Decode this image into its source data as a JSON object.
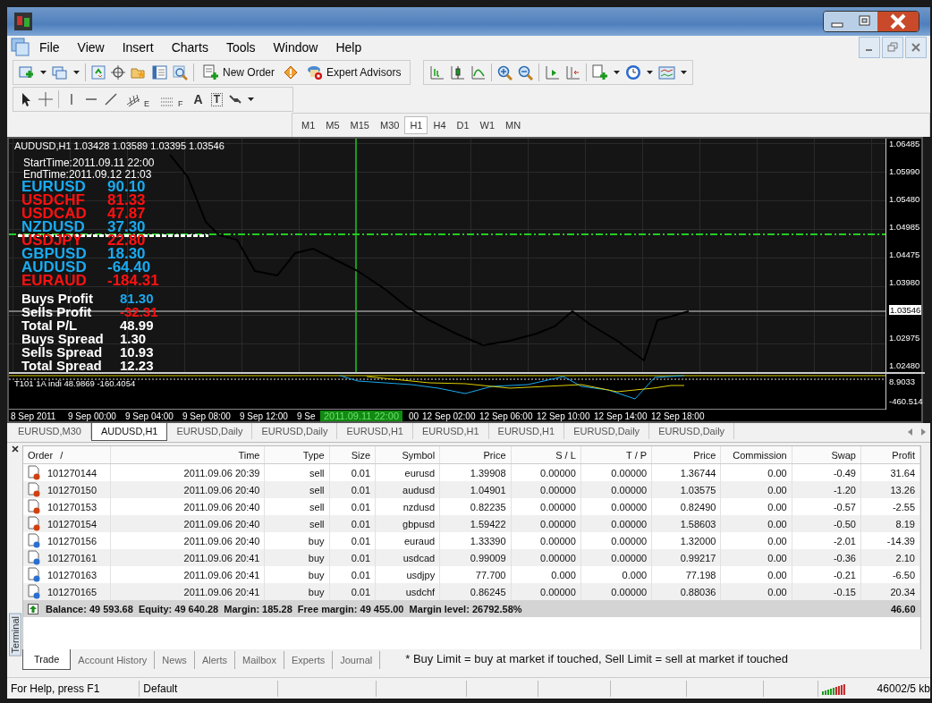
{
  "menu": [
    "File",
    "View",
    "Insert",
    "Charts",
    "Tools",
    "Window",
    "Help"
  ],
  "toolbar": {
    "new_order": "New Order",
    "expert_advisors": "Expert Advisors"
  },
  "drawing_tools": {
    "channel_mark": "E",
    "fibo_mark": "F",
    "text_tool": "A",
    "label_tool": "T"
  },
  "timeframes": [
    {
      "label": "M1",
      "selected": false
    },
    {
      "label": "M5",
      "selected": false
    },
    {
      "label": "M15",
      "selected": false
    },
    {
      "label": "M30",
      "selected": false
    },
    {
      "label": "H1",
      "selected": true
    },
    {
      "label": "H4",
      "selected": false
    },
    {
      "label": "D1",
      "selected": false
    },
    {
      "label": "W1",
      "selected": false
    },
    {
      "label": "MN",
      "selected": false
    }
  ],
  "chart": {
    "header": "AUDUSD,H1  1.03428 1.03589 1.03395 1.03546",
    "start_time": "StartTime:2011.09.11 22:00",
    "end_time": "EndTime:2011.09.12 21:03",
    "pairs": [
      {
        "symbol": "EURUSD",
        "value": "90.10",
        "color": "#19aaf0"
      },
      {
        "symbol": "USDCHF",
        "value": "81.33",
        "color": "#ff1111"
      },
      {
        "symbol": "USDCAD",
        "value": "47.87",
        "color": "#ff1111"
      },
      {
        "symbol": "NZDUSD",
        "value": "37.30",
        "color": "#19aaf0"
      },
      {
        "symbol": "USDJPY",
        "value": "22.80",
        "color": "#ff1111"
      },
      {
        "symbol": "GBPUSD",
        "value": "18.30",
        "color": "#19aaf0"
      },
      {
        "symbol": "AUDUSD",
        "value": "-64.40",
        "color": "#19aaf0"
      },
      {
        "symbol": "EURAUD",
        "value": "-184.31",
        "color": "#ff1111"
      }
    ],
    "summary": [
      {
        "label": "Buys Profit",
        "value": "81.30",
        "color": "#19aaf0"
      },
      {
        "label": "Sells Profit",
        "value": "-32.31",
        "color": "#ff1111"
      },
      {
        "label": "Total P/L",
        "value": "48.99",
        "color": "#ffffff"
      },
      {
        "label": "Buys Spread",
        "value": "1.30",
        "color": "#ffffff"
      },
      {
        "label": "Sells Spread",
        "value": "10.93",
        "color": "#ffffff"
      },
      {
        "label": "Total Spread",
        "value": "12.23",
        "color": "#ffffff"
      }
    ],
    "price_ticks": [
      {
        "label": "1.06485",
        "current": false
      },
      {
        "label": "1.05990",
        "current": false
      },
      {
        "label": "1.05480",
        "current": false
      },
      {
        "label": "1.04985",
        "current": false
      },
      {
        "label": "1.04475",
        "current": false
      },
      {
        "label": "1.03980",
        "current": false
      },
      {
        "label": "1.03546",
        "current": true
      },
      {
        "label": "1.02975",
        "current": false
      },
      {
        "label": "1.02480",
        "current": false
      }
    ],
    "indicator": {
      "label": "T101 1A indi 48.9869 -160.4054",
      "ticks": [
        "8.9033",
        "-460.514"
      ]
    },
    "time_axis": {
      "before": [
        "8 Sep 2011",
        "9 Sep 00:00",
        "9 Sep 04:00",
        "9 Sep 08:00",
        "9 Sep 12:00",
        "9 Se"
      ],
      "cursor": "2011.09.11 22:00",
      "cursor_tail": "00",
      "after": [
        "12 Sep 02:00",
        "12 Sep 06:00",
        "12 Sep 10:00",
        "12 Sep 14:00",
        "12 Sep 18:00"
      ]
    }
  },
  "chart_tabs": [
    {
      "label": "EURUSD,M30",
      "selected": false
    },
    {
      "label": "AUDUSD,H1",
      "selected": true
    },
    {
      "label": "EURUSD,Daily",
      "selected": false
    },
    {
      "label": "EURUSD,Daily",
      "selected": false
    },
    {
      "label": "EURUSD,H1",
      "selected": false
    },
    {
      "label": "EURUSD,H1",
      "selected": false
    },
    {
      "label": "EURUSD,H1",
      "selected": false
    },
    {
      "label": "EURUSD,Daily",
      "selected": false
    },
    {
      "label": "EURUSD,Daily",
      "selected": false
    }
  ],
  "terminal": {
    "title": "Terminal",
    "sort_mark": "/",
    "columns": [
      "Order",
      "Time",
      "Type",
      "Size",
      "Symbol",
      "Price",
      "S / L",
      "T / P",
      "Price",
      "Commission",
      "Swap",
      "Profit"
    ],
    "rows": [
      {
        "kind": "sell",
        "cells": [
          "101270144",
          "2011.09.06 20:39",
          "sell",
          "0.01",
          "eurusd",
          "1.39908",
          "0.00000",
          "0.00000",
          "1.36744",
          "0.00",
          "-0.49",
          "31.64"
        ]
      },
      {
        "kind": "sell",
        "cells": [
          "101270150",
          "2011.09.06 20:40",
          "sell",
          "0.01",
          "audusd",
          "1.04901",
          "0.00000",
          "0.00000",
          "1.03575",
          "0.00",
          "-1.20",
          "13.26"
        ]
      },
      {
        "kind": "sell",
        "cells": [
          "101270153",
          "2011.09.06 20:40",
          "sell",
          "0.01",
          "nzdusd",
          "0.82235",
          "0.00000",
          "0.00000",
          "0.82490",
          "0.00",
          "-0.57",
          "-2.55"
        ]
      },
      {
        "kind": "sell",
        "cells": [
          "101270154",
          "2011.09.06 20:40",
          "sell",
          "0.01",
          "gbpusd",
          "1.59422",
          "0.00000",
          "0.00000",
          "1.58603",
          "0.00",
          "-0.50",
          "8.19"
        ]
      },
      {
        "kind": "buy",
        "cells": [
          "101270156",
          "2011.09.06 20:40",
          "buy",
          "0.01",
          "euraud",
          "1.33390",
          "0.00000",
          "0.00000",
          "1.32000",
          "0.00",
          "-2.01",
          "-14.39"
        ]
      },
      {
        "kind": "buy",
        "cells": [
          "101270161",
          "2011.09.06 20:41",
          "buy",
          "0.01",
          "usdcad",
          "0.99009",
          "0.00000",
          "0.00000",
          "0.99217",
          "0.00",
          "-0.36",
          "2.10"
        ]
      },
      {
        "kind": "buy",
        "cells": [
          "101270163",
          "2011.09.06 20:41",
          "buy",
          "0.01",
          "usdjpy",
          "77.700",
          "0.000",
          "0.000",
          "77.198",
          "0.00",
          "-0.21",
          "-6.50"
        ]
      },
      {
        "kind": "buy",
        "cells": [
          "101270165",
          "2011.09.06 20:41",
          "buy",
          "0.01",
          "usdchf",
          "0.86245",
          "0.00000",
          "0.00000",
          "0.88036",
          "0.00",
          "-0.15",
          "20.34"
        ]
      }
    ],
    "balance": "Balance: 49 593.68  Equity: 49 640.28  Margin: 185.28  Free margin: 49 455.00  Margin level: 26792.58%",
    "total_profit": "46.60",
    "tabs": [
      {
        "label": "Trade",
        "selected": true
      },
      {
        "label": "Account History",
        "selected": false
      },
      {
        "label": "News",
        "selected": false
      },
      {
        "label": "Alerts",
        "selected": false
      },
      {
        "label": "Mailbox",
        "selected": false
      },
      {
        "label": "Experts",
        "selected": false
      },
      {
        "label": "Journal",
        "selected": false
      }
    ],
    "note": "* Buy Limit = buy at market if touched, Sell Limit = sell at market if touched"
  },
  "status_bar": [
    "For Help, press F1",
    "Default",
    "46002/5 kb"
  ]
}
